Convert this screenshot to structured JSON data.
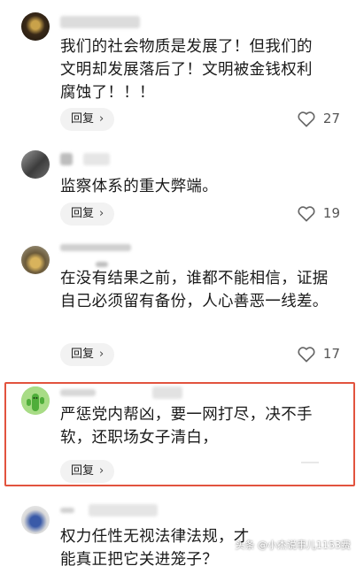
{
  "comments": [
    {
      "text": "我们的社会物质是发展了！但我们的文明却发展落后了！文明被金钱权利腐蚀了！！！",
      "reply_label": "回复",
      "likes": "27"
    },
    {
      "text": "监察体系的重大弊端。",
      "reply_label": "回复",
      "likes": "19"
    },
    {
      "text": "在没有结果之前，谁都不能相信，证据自己必须留有备份，人心善恶一线差。",
      "reply_label": "回复",
      "likes": "17"
    },
    {
      "text": "严惩党内帮凶，要一网打尽，决不手软，还职场女子清白，",
      "reply_label": "回复",
      "likes": ""
    },
    {
      "text": "权力任性无视法律法规，才能真正把它关进笼子？",
      "reply_label": "",
      "likes": ""
    }
  ],
  "watermark": {
    "text": "头条 @小杰说事儿1153费"
  },
  "colors": {
    "highlight_border": "#e2533e",
    "reply_bg": "#f2f2f2"
  },
  "icons": {
    "like": "heart-outline-icon",
    "reply_chevron": "chevron-right-icon"
  }
}
